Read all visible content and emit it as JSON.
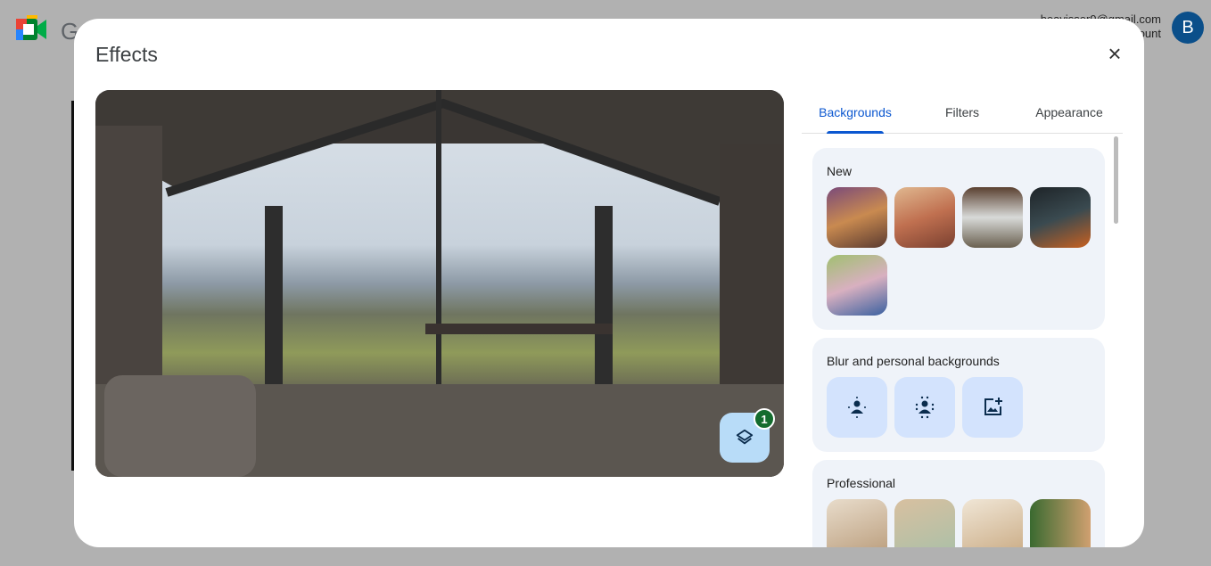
{
  "app": {
    "logo_letter": "G",
    "account_email": "beavisser9@gmail.com",
    "account_sub": "Switch account",
    "avatar_letter": "B"
  },
  "dialog": {
    "title": "Effects",
    "close_label": "×",
    "layers_badge": "1"
  },
  "tabs": [
    {
      "label": "Backgrounds",
      "active": true
    },
    {
      "label": "Filters"
    },
    {
      "label": "Appearance"
    }
  ],
  "sections": {
    "new": {
      "title": "New",
      "thumbs": [
        "#b07050",
        "#c08060",
        "#7a6a58",
        "#2b3035",
        "#b0a070"
      ]
    },
    "blur": {
      "title": "Blur and personal backgrounds",
      "items": [
        "slight-blur-icon",
        "blur-icon",
        "add-image-icon"
      ]
    },
    "professional": {
      "title": "Professional",
      "thumbs": [
        "#d8cbb8",
        "#c9d3c0",
        "#e3d6c2",
        "#c9a878"
      ]
    }
  }
}
